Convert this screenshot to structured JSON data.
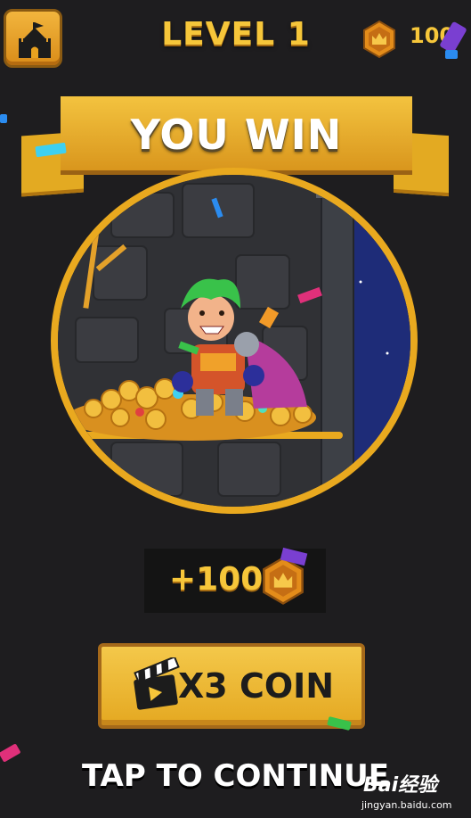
{
  "hud": {
    "level_title": "LEVEL 1",
    "coin_amount": "100"
  },
  "icons": {
    "home": "castle-icon",
    "coin": "crown-coin-icon",
    "video": "clapperboard-icon"
  },
  "result": {
    "banner_title": "YOU WIN",
    "reward_amount": "+100"
  },
  "actions": {
    "multiply_label": "X3 COIN",
    "continue_label": "TAP TO CONTINUE"
  },
  "watermark": {
    "brand": "Bai经验",
    "url": "jingyan.baidu.com"
  },
  "colors": {
    "background": "#1e1d1f",
    "gold": "#f6c63a",
    "banner": "#e3aa22"
  }
}
